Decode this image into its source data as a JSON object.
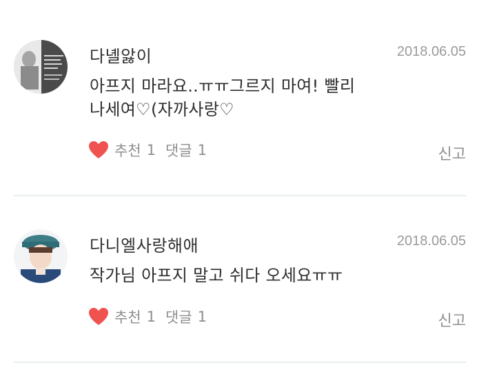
{
  "comments": [
    {
      "author": "다녤앓이",
      "date": "2018.06.05",
      "body_line1": "아프지 마라요..ㅠㅠ그르지 마여! 빨리",
      "body_line2": "나세여♡(자까사랑♡",
      "like_label": "추천",
      "like_count": "1",
      "reply_label": "댓글",
      "reply_count": "1",
      "report_label": "신고"
    },
    {
      "author": "다니엘사랑해애",
      "date": "2018.06.05",
      "body_line1": "작가님 아프지 말고 쉬다 오세요ㅠㅠ",
      "like_label": "추천",
      "like_count": "1",
      "reply_label": "댓글",
      "reply_count": "1",
      "report_label": "신고"
    }
  ],
  "colors": {
    "heart": "#f0524f",
    "divider": "#e8efe9",
    "date": "#9a9a9a",
    "meta": "#8e8e8e"
  },
  "icons": {
    "like": "heart-icon"
  }
}
